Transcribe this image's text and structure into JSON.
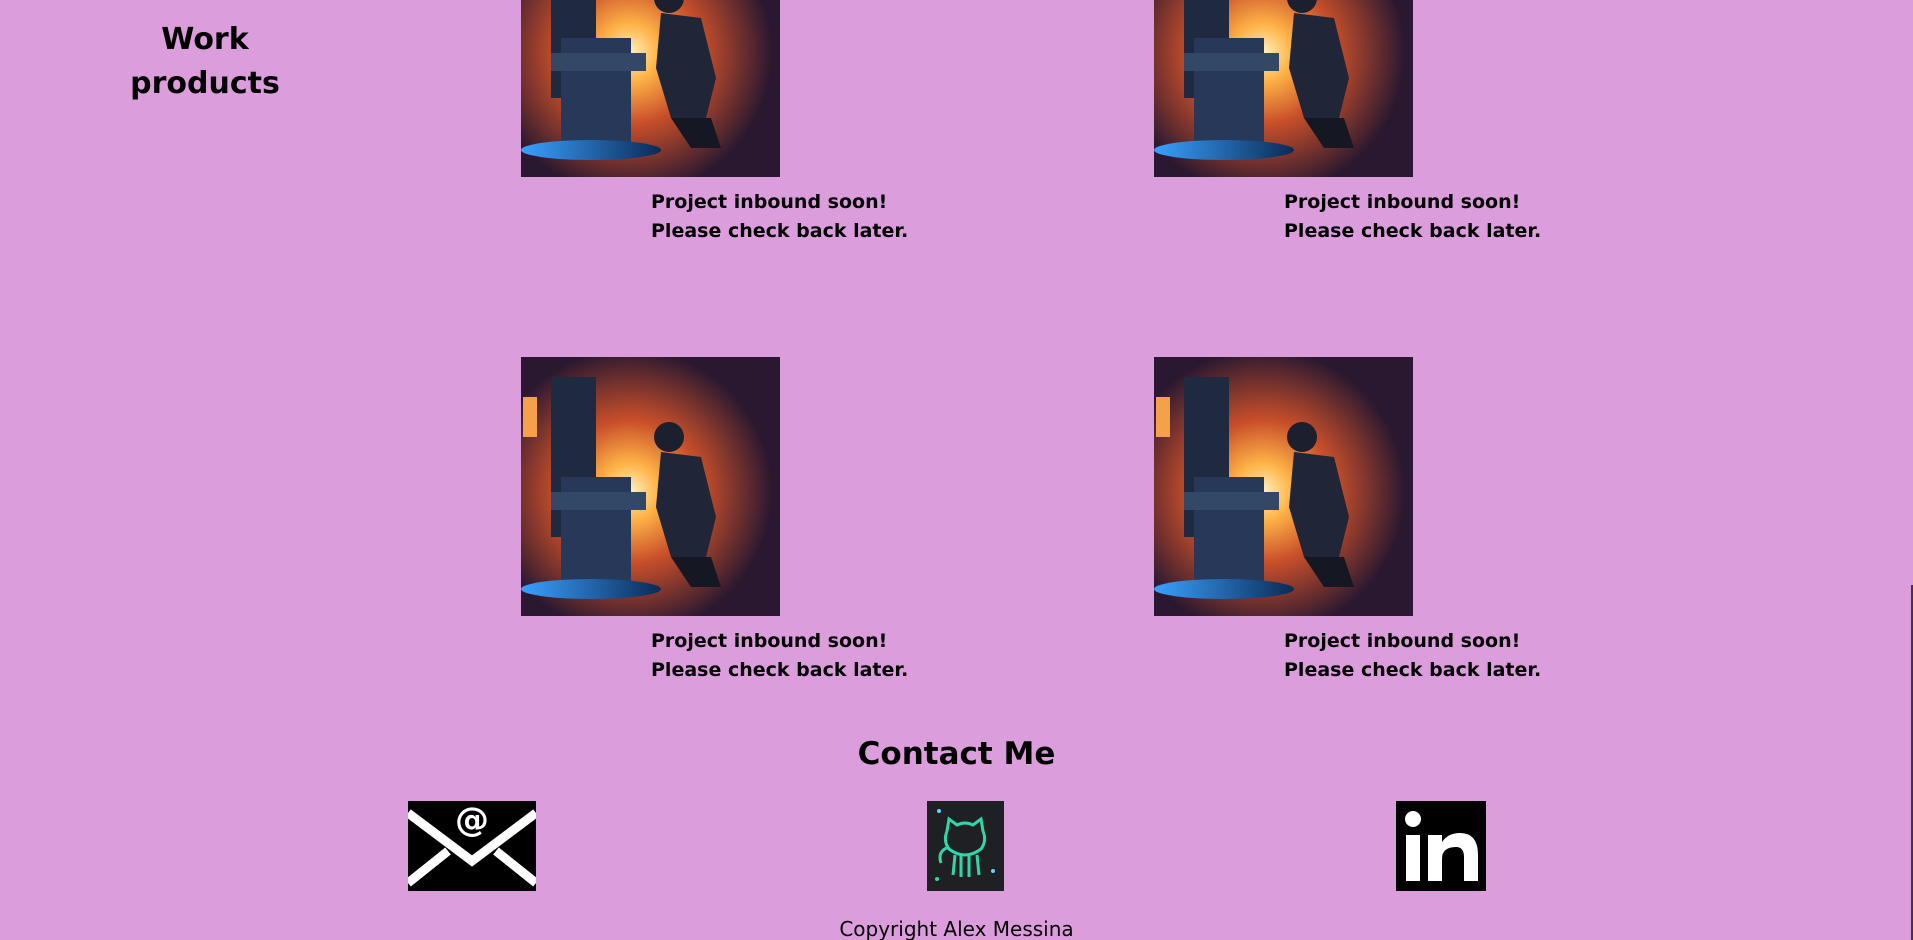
{
  "work": {
    "title": "Work products",
    "projects": [
      {
        "caption_line1": "Project inbound soon!",
        "caption_line2": "Please check back later.",
        "image": "blacksmith-forge-artwork"
      },
      {
        "caption_line1": "Project inbound soon!",
        "caption_line2": "Please check back later.",
        "image": "blacksmith-forge-artwork"
      },
      {
        "caption_line1": "Project inbound soon!",
        "caption_line2": "Please check back later.",
        "image": "blacksmith-forge-artwork"
      },
      {
        "caption_line1": "Project inbound soon!",
        "caption_line2": "Please check back later.",
        "image": "blacksmith-forge-artwork"
      }
    ]
  },
  "contact": {
    "title": "Contact Me",
    "links": [
      {
        "icon": "email-icon"
      },
      {
        "icon": "github-icon"
      },
      {
        "icon": "linkedin-icon"
      }
    ]
  },
  "footer": {
    "copyright": "Copyright Alex Messina"
  },
  "colors": {
    "background": "#dc9ddc",
    "github_accent": "#31d6a8"
  }
}
